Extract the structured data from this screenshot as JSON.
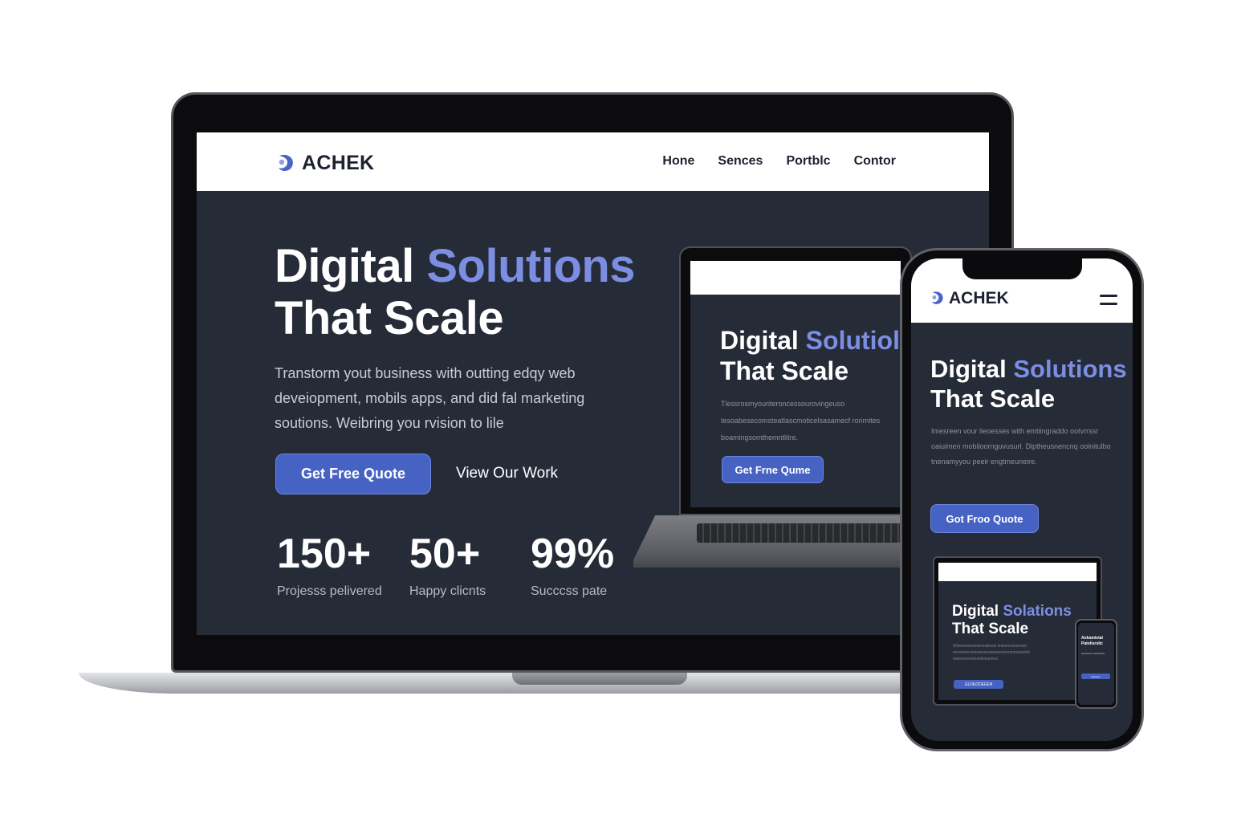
{
  "brand": {
    "name": "ACHEK",
    "logo_icon": "swirl-logo-icon",
    "accent_color": "#7b8ee2",
    "button_color": "#4663c4",
    "dark_bg": "#262b38"
  },
  "laptop": {
    "nav": {
      "links": [
        "Hone",
        "Sences",
        "Portblc",
        "Contor"
      ]
    },
    "hero": {
      "title_line1_a": "Digital",
      "title_line1_b": "Solutions",
      "title_line2": "That Scale",
      "description": "Transtorm yout business with outting edqy web deveiopment, mobils apps, and did fal marketing soutions. Weibring you rvision to lile",
      "primary_button": "Get Free Quote",
      "secondary_button": "View Our Work"
    },
    "stats": [
      {
        "value": "150+",
        "label": "Projesss pelivered"
      },
      {
        "value": "50+",
        "label": "Happy clicnts"
      },
      {
        "value": "99%",
        "label": "Succcss pate"
      }
    ]
  },
  "tablet": {
    "title_line1_a": "Digital",
    "title_line1_b": "Solutiol",
    "title_line2": "That Scale",
    "description": "Tlessrosmyouriteroncessourovingeuso tesoabesecomsteatlascmoticelsasamecf rorimites boamingsomthemntlitre.",
    "primary_button": "Get Frne Qume"
  },
  "phone": {
    "brand_name": "ACHEK",
    "menu_icon": "hamburger-menu-icon",
    "title_line1_a": "Digital",
    "title_line1_b": "Solutions",
    "title_line2": "That Scale",
    "description": "Imesreen vour lieoesses with emtiingraddo ootvrrssr oaiuimen mobiloornguvusurl. Diptheusnencnq ooinitulbo tnenamyyou peeir engtmeuneire.",
    "primary_button": "Got Froo Quote"
  },
  "mini_laptop": {
    "title_line1_a": "Digital",
    "title_line1_b": "Solations",
    "title_line2": "That Scale",
    "description": "Wisieeewoaeemowliowe iimeemuoseoaw memmeeumeaeoeeoweoeemonmosesuteii woeoeneowneelwsumeoi",
    "primary_button": "GLDEODEEEN"
  },
  "micro_phone": {
    "title_line1": "Aohamletal",
    "title_line2": "Patolisrolic",
    "description": "weeswaon weeewaeo",
    "primary_button": "weeeew"
  }
}
